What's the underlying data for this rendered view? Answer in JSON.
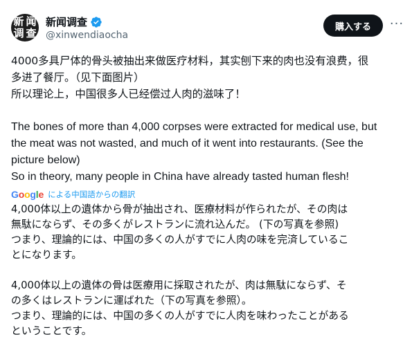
{
  "author": {
    "display_name": "新闻调查",
    "handle": "@xinwendiaocha",
    "avatar_chars": [
      "新",
      "闻",
      "调",
      "查"
    ],
    "verified_icon": "verified-badge-icon"
  },
  "actions": {
    "subscribe_label": "購入する",
    "more_icon": "more-horizontal-icon"
  },
  "post": {
    "zh_lines": [
      "4000多具尸体的骨头被抽出来做医疗材料，其实刨下来的肉也没有浪费，很",
      "多进了餐厅。（见下面图片）",
      "所以理论上，中国很多人已经偿过人肉的滋味了！"
    ],
    "en_lines": [
      "The bones of more than 4,000 corpses were extracted for medical use, but",
      "the meat was not wasted, and much of it went into restaurants. (See the",
      "picture below)",
      "So in theory, many people in China have already tasted human flesh!"
    ]
  },
  "translation": {
    "provider": "Google",
    "link_text": "による中国語からの翻訳",
    "para1_lines": [
      "4,000体以上の遺体から骨が抽出され、医療材料が作られたが、その肉は",
      "無駄にならず、その多くがレストランに流れ込んだ。 (下の写真を参照)",
      "つまり、理論的には、中国の多くの人がすでに人肉の味を完済しているこ",
      "とになります。"
    ],
    "para2_lines": [
      "4,000体以上の遺体の骨は医療用に採取されたが、肉は無駄にならず、そ",
      "の多くはレストランに運ばれた（下の写真を参照）。",
      "つまり、理論的には、中国の多くの人がすでに人肉を味わったことがある",
      "ということです。"
    ]
  },
  "colors": {
    "verified": "#1d9bf0",
    "link": "#1d9bf0",
    "secondary_text": "#536471",
    "button_bg": "#0f1419"
  }
}
